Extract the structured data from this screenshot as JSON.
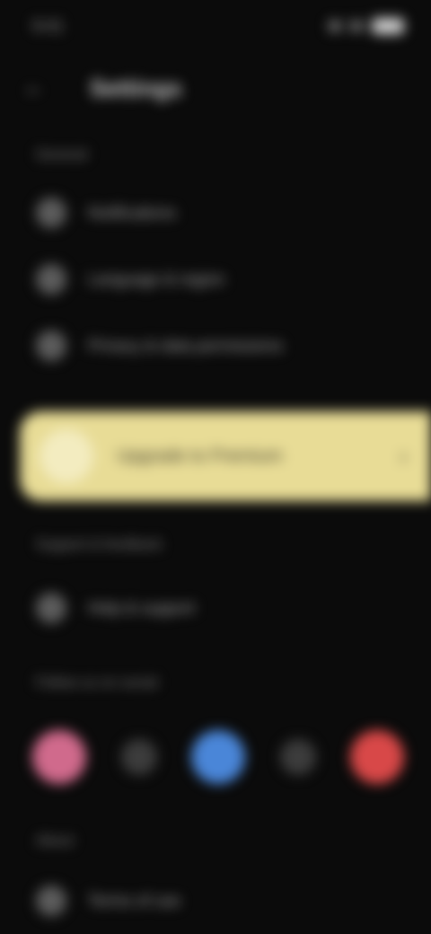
{
  "status_bar": {
    "time": "9:41"
  },
  "header": {
    "title": "Settings"
  },
  "sections": {
    "general": "General",
    "support": "Support & feedback",
    "follow": "Follow us on social",
    "about": "About"
  },
  "general_items": [
    {
      "label": "Notifications"
    },
    {
      "label": "Language & region"
    },
    {
      "label": "Privacy & data permissions"
    }
  ],
  "highlight": {
    "label": "Upgrade to Premium"
  },
  "support_items": [
    {
      "label": "Help & support"
    }
  ],
  "about_items": [
    {
      "label": "Terms of use"
    }
  ],
  "social_icons": [
    "instagram-icon",
    "x-icon",
    "facebook-icon",
    "tiktok-icon",
    "youtube-icon"
  ],
  "colors": {
    "background": "#0b0b0b",
    "highlight": "#e8dc96",
    "instagram": "#d06a8c",
    "facebook": "#4a86d8",
    "youtube": "#d84848"
  }
}
